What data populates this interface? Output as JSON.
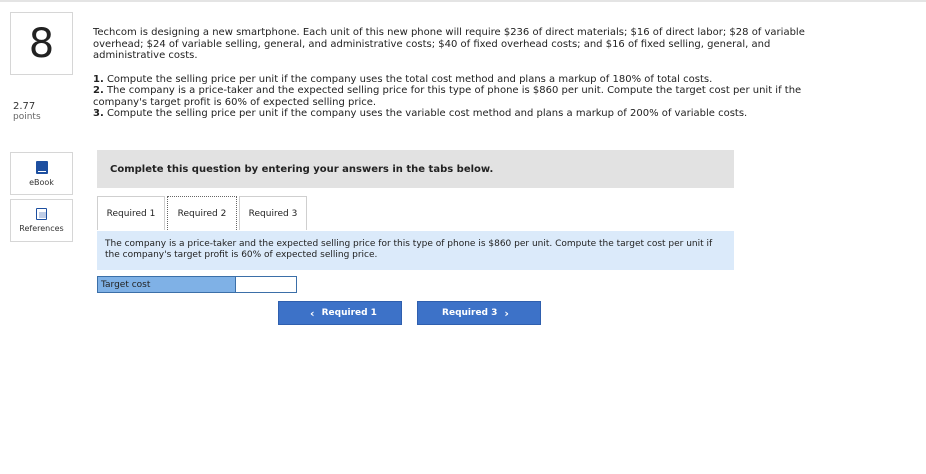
{
  "question": {
    "number": "8",
    "points_value": "2.77",
    "points_label": "points"
  },
  "sidebar": {
    "ebook_label": "eBook",
    "references_label": "References"
  },
  "problem": {
    "intro": "Techcom is designing a new smartphone. Each unit of this new phone will require $236 of direct materials; $16 of direct labor; $28 of variable overhead; $24 of variable selling, general, and administrative costs; $40 of fixed overhead costs; and $16 of fixed selling, general, and administrative costs.",
    "requirements": [
      {
        "num": "1.",
        "text": "Compute the selling price per unit if the company uses the total cost method and plans a markup of 180% of total costs."
      },
      {
        "num": "2.",
        "text": "The company is a price-taker and the expected selling price for this type of phone is $860 per unit. Compute the target cost per unit if the company's target profit is 60% of expected selling price."
      },
      {
        "num": "3.",
        "text": "Compute the selling price per unit if the company uses the variable cost method and plans a markup of 200% of variable costs."
      }
    ]
  },
  "banner": "Complete this question by entering your answers in the tabs below.",
  "tabs": [
    {
      "label": "Required 1"
    },
    {
      "label": "Required 2"
    },
    {
      "label": "Required 3"
    }
  ],
  "active_tab": "Required 2",
  "instruction": "The company is a price-taker and the expected selling price for this type of phone is $860 per unit. Compute the target cost per unit if the company's target profit is 60% of expected selling price.",
  "answer": {
    "label": "Target cost",
    "value": ""
  },
  "nav": {
    "prev": "Required 1",
    "next": "Required 3",
    "prev_chevron": "‹",
    "next_chevron": "›"
  },
  "colors": {
    "button": "#3d72c8",
    "instruction_bg": "#dbeafa",
    "label_bg": "#7fb1e6",
    "banner_bg": "#e2e2e2"
  }
}
